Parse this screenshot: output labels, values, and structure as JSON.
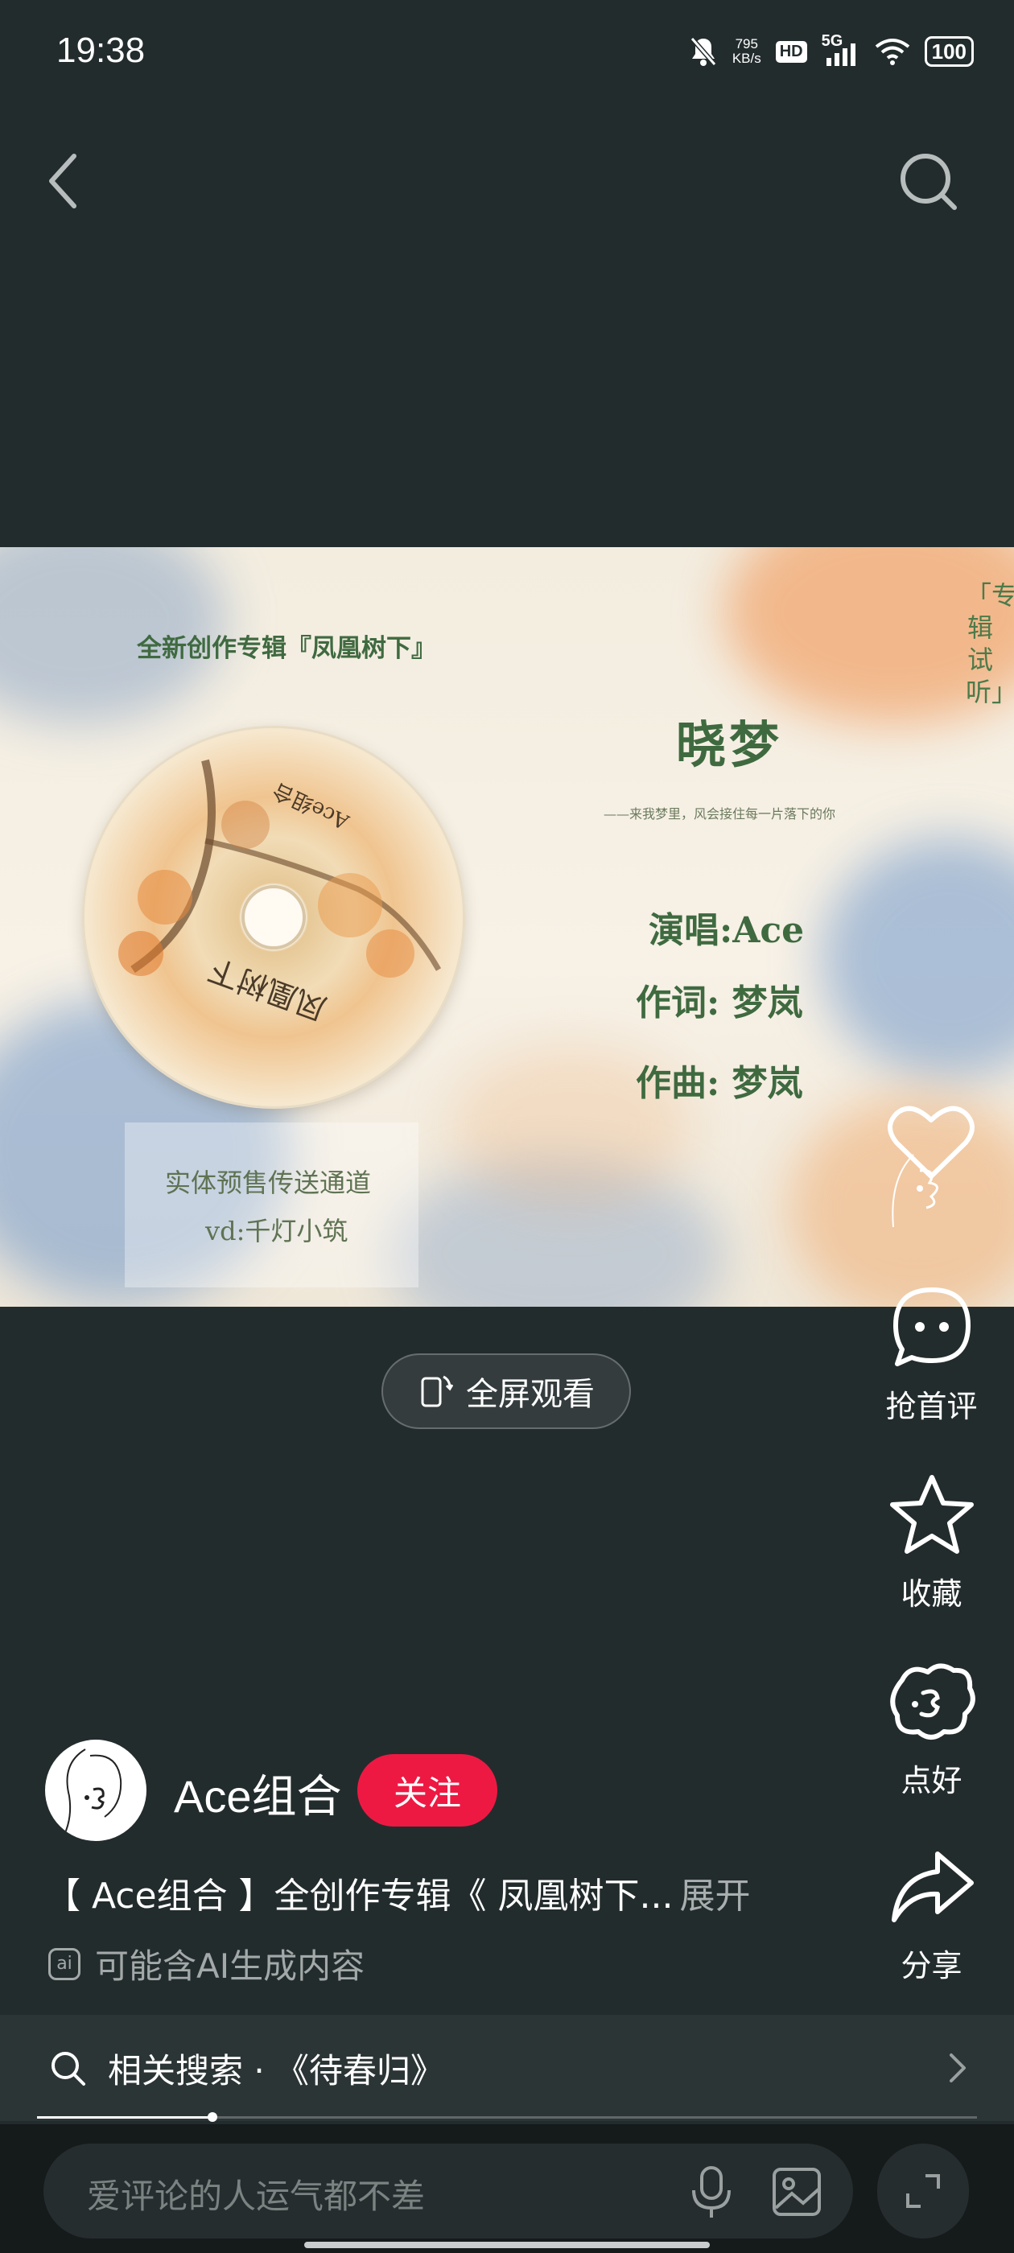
{
  "status_bar": {
    "time": "19:38",
    "net_speed_value": "795",
    "net_speed_unit": "KB/s",
    "hd_label": "HD",
    "network": "5G",
    "battery": "100",
    "icons": [
      "mute-bell-icon",
      "hd-icon",
      "5g-signal-icon",
      "wifi-icon",
      "battery-icon"
    ]
  },
  "header": {
    "back_icon": "chevron-left-icon",
    "search_icon": "search-icon"
  },
  "video": {
    "album_line": "全新创作专辑『凤凰树下』",
    "song_title": "晓梦",
    "song_subtitle": "——来我梦里，风会接住每一片落下的你",
    "singer": "演唱:Ace",
    "lyricist": "作词: 梦岚",
    "composer": "作曲: 梦岚",
    "side_label": "「专辑试听」",
    "presale_line1": "实体预售传送通道",
    "presale_line2": "vd:千灯小筑",
    "disc_title": "凤凰树下",
    "disc_artist": "Ace组合"
  },
  "fullscreen": {
    "label": "全屏观看",
    "icon": "rotate-phone-icon"
  },
  "actions": {
    "like": {
      "label": "",
      "icon": "heart-icon"
    },
    "comment": {
      "label": "抢首评",
      "icon": "chat-bubble-icon"
    },
    "favorite": {
      "label": "收藏",
      "icon": "star-icon"
    },
    "nice": {
      "label": "点好",
      "icon": "sticker-icon"
    },
    "share": {
      "label": "分享",
      "icon": "share-arrow-icon"
    }
  },
  "author": {
    "name": "Ace组合",
    "follow_label": "关注"
  },
  "description": {
    "text": "【 Ace组合 】全创作专辑《 凤凰树下...",
    "more_label": "展开"
  },
  "ai_notice": {
    "badge": "ai",
    "text": "可能含AI生成内容"
  },
  "related_search": {
    "text": "相关搜索 · 《待春归》",
    "icon": "search-icon"
  },
  "progress": {
    "fraction": 0.187
  },
  "comment_bar": {
    "placeholder": "爱评论的人运气都不差",
    "icons": [
      "microphone-icon",
      "image-icon",
      "expand-icon"
    ]
  },
  "colors": {
    "background": "#232c2d",
    "follow": "#ee1943",
    "video_text": "#3f6a40"
  }
}
